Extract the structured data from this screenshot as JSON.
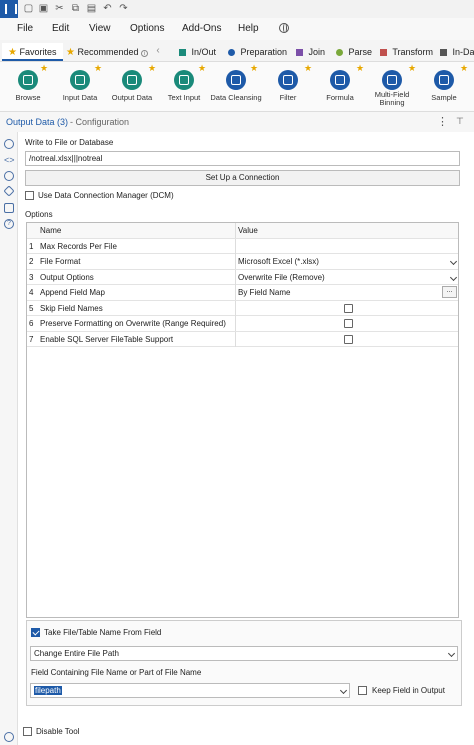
{
  "menu": {
    "file": "File",
    "edit": "Edit",
    "view": "View",
    "options": "Options",
    "addons": "Add-Ons",
    "help": "Help"
  },
  "tabs": {
    "favorites": "Favorites",
    "recommended": "Recommended",
    "in_out": "In/Out",
    "preparation": "Preparation",
    "join": "Join",
    "parse": "Parse",
    "transform": "Transform",
    "in_database": "In-Dat"
  },
  "colors": {
    "in_out": "#1a8a7a",
    "preparation": "#1e5aa8",
    "join": "#7b4fa8",
    "parse": "#7aa83a",
    "transform": "#c0504d",
    "in_database": "#555555"
  },
  "tools": [
    {
      "label": "Browse",
      "icon": "browse-icon",
      "color": "#1a8a7a"
    },
    {
      "label": "Input Data",
      "icon": "input-data-icon",
      "color": "#1a8a7a"
    },
    {
      "label": "Output Data",
      "icon": "output-data-icon",
      "color": "#1a8a7a"
    },
    {
      "label": "Text Input",
      "icon": "text-input-icon",
      "color": "#1a8a7a"
    },
    {
      "label": "Data Cleansing",
      "icon": "data-cleansing-icon",
      "color": "#1e5aa8"
    },
    {
      "label": "Filter",
      "icon": "filter-icon",
      "color": "#1e5aa8"
    },
    {
      "label": "Formula",
      "icon": "formula-icon",
      "color": "#1e5aa8"
    },
    {
      "label": "Multi-Field Binning",
      "icon": "multi-field-binning-icon",
      "color": "#1e5aa8"
    },
    {
      "label": "Sample",
      "icon": "sample-icon",
      "color": "#1e5aa8"
    }
  ],
  "panel": {
    "title": "Output Data (3)",
    "subtitle": "- Configuration"
  },
  "config": {
    "write_label": "Write to File or Database",
    "path_value": "/notreal.xlsx|||notreal",
    "setup_button": "Set Up a Connection",
    "dcm_label": "Use Data Connection Manager (DCM)",
    "options_label": "Options",
    "grid_header_name": "Name",
    "grid_header_value": "Value",
    "rows": [
      {
        "num": "1",
        "name": "Max Records Per File",
        "value": ""
      },
      {
        "num": "2",
        "name": "File Format",
        "value": "Microsoft Excel (*.xlsx)"
      },
      {
        "num": "3",
        "name": "Output Options",
        "value": "Overwrite File (Remove)"
      },
      {
        "num": "4",
        "name": "Append Field Map",
        "value": "By Field Name"
      },
      {
        "num": "5",
        "name": "Skip Field Names",
        "value": ""
      },
      {
        "num": "6",
        "name": "Preserve Formatting on Overwrite (Range Required)",
        "value": ""
      },
      {
        "num": "7",
        "name": "Enable SQL Server FileTable Support",
        "value": ""
      }
    ],
    "ellipsis": "...",
    "take_name_label": "Take File/Table Name From Field",
    "change_path_value": "Change Entire File Path",
    "field_label": "Field Containing File Name or Part of File Name",
    "field_value": "filepath",
    "keep_field_label": "Keep Field in Output",
    "disable_tool_label": "Disable Tool"
  }
}
